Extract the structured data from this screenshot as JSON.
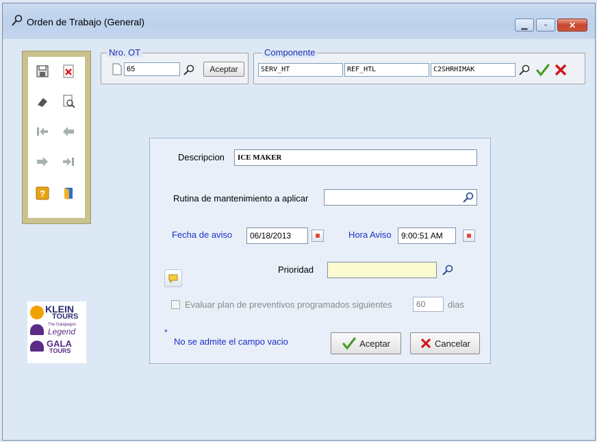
{
  "window": {
    "title": "Orden de Trabajo (General)",
    "min_icon": "minimize-icon",
    "max_icon": "maximize-icon",
    "close_icon": "close-icon"
  },
  "toolbar": {
    "buttons": [
      {
        "name": "save-button",
        "icon": "save-icon"
      },
      {
        "name": "delete-button",
        "icon": "delete-x-icon"
      },
      {
        "name": "erase-button",
        "icon": "eraser-icon"
      },
      {
        "name": "preview-button",
        "icon": "print-preview-icon"
      },
      {
        "name": "first-record-button",
        "icon": "first-record-icon"
      },
      {
        "name": "previous-record-button",
        "icon": "previous-arrow-icon"
      },
      {
        "name": "next-record-button",
        "icon": "next-arrow-icon"
      },
      {
        "name": "last-record-button",
        "icon": "last-record-icon"
      },
      {
        "name": "help-button",
        "icon": "help-icon"
      },
      {
        "name": "exit-button",
        "icon": "exit-door-icon"
      }
    ]
  },
  "nro_ot": {
    "legend": "Nro. OT",
    "value": "65",
    "accept_label": "Aceptar"
  },
  "componente": {
    "legend": "Componente",
    "field1": "SERV_HT",
    "field2": "REF_HTL",
    "field3": "C2SHRHIMAK"
  },
  "form": {
    "descripcion_label": "Descripcion",
    "descripcion_value": "ICE MAKER",
    "rutina_label": "Rutina de mantenimiento a aplicar",
    "rutina_value": "",
    "fecha_label": "Fecha de aviso",
    "fecha_value": "06/18/2013",
    "hora_label": "Hora Aviso",
    "hora_value": "9:00:51 AM",
    "prioridad_label": "Prioridad",
    "prioridad_value": "",
    "evaluar_label": "Evaluar plan de preventivos programados siguientes",
    "evaluar_days": "60",
    "dias_label": "dias",
    "asterisk": "*",
    "required_note": "No se admite el campo vacio",
    "accept_label": "Aceptar",
    "cancel_label": "Cancelar"
  },
  "logo": {
    "line1": "KLEIN",
    "line2": "TOURS",
    "line3": "The Galapagos",
    "line4": "Legend",
    "line5": "GALA",
    "line6": "TOURS"
  },
  "colors": {
    "accent_blue": "#1b2fc7",
    "prioridad_bg": "#fbfbd2",
    "toolbar_frame": "#c9c28e"
  }
}
